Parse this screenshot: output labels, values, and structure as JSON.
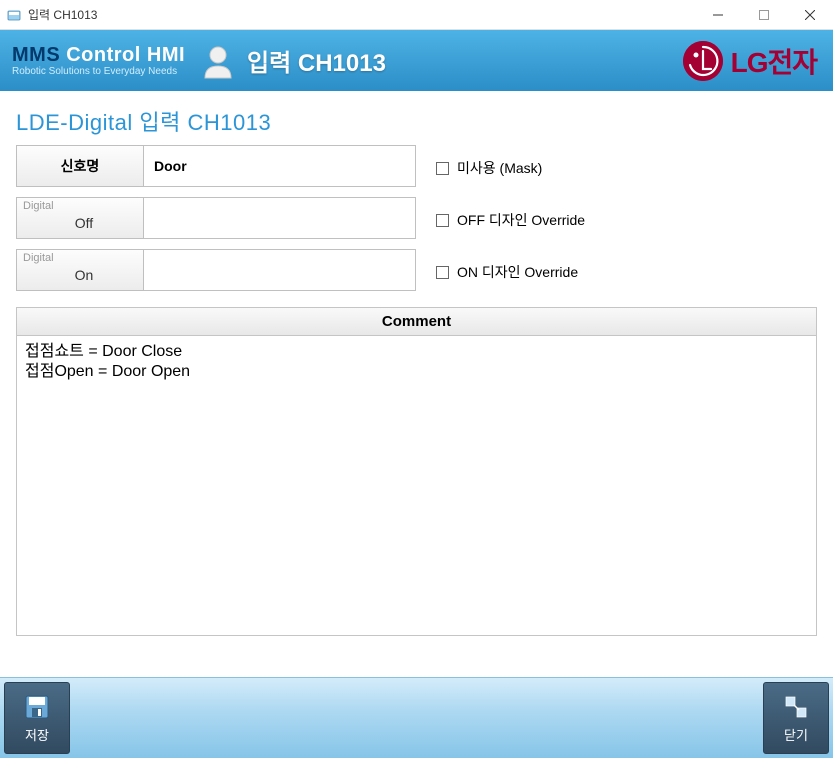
{
  "window": {
    "title": "입력 CH1013"
  },
  "header": {
    "brand_mms": "MMS",
    "brand_rest": " Control HMI",
    "brand_sub": "Robotic Solutions to Everyday Needs",
    "page_title": "입력 CH1013",
    "logo_text": "LG전자"
  },
  "main": {
    "section_title": "LDE-Digital 입력 CH1013",
    "rows": {
      "signal": {
        "label": "신호명",
        "value": "Door"
      },
      "off": {
        "mini": "Digital",
        "label": "Off",
        "value": ""
      },
      "on": {
        "mini": "Digital",
        "label": "On",
        "value": ""
      }
    },
    "checks": {
      "mask": {
        "label": "미사용 (Mask)",
        "checked": false
      },
      "off_override": {
        "label": "OFF 디자인 Override",
        "checked": false
      },
      "on_override": {
        "label": "ON 디자인 Override",
        "checked": false
      }
    },
    "comment": {
      "header": "Comment",
      "body": "접점쇼트 = Door Close\n접점Open = Door Open"
    }
  },
  "footer": {
    "save": "저장",
    "close": "닫기"
  }
}
